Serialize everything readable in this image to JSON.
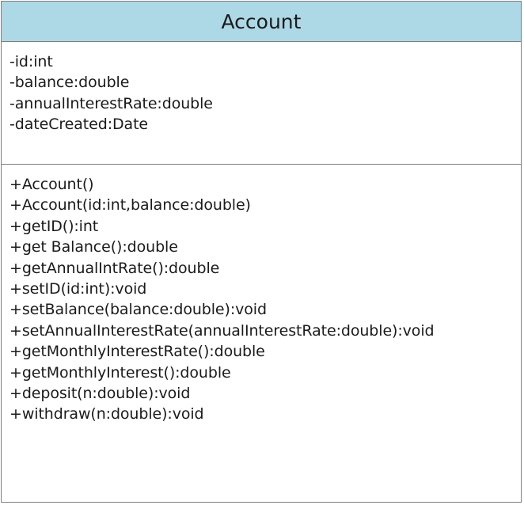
{
  "class": {
    "name": "Account",
    "header_color": "#add8e6",
    "attributes": [
      "-id:int",
      "-balance:double",
      "-annualInterestRate:double",
      "-dateCreated:Date"
    ],
    "methods": [
      "+Account()",
      "+Account(id:int,balance:double)",
      "+getID():int",
      "+get Balance():double",
      "+getAnnualIntRate():double",
      "+setID(id:int):void",
      "+setBalance(balance:double):void",
      "+setAnnualInterestRate(annualInterestRate:double):void",
      "+getMonthlyInterestRate():double",
      "+getMonthlyInterest():double",
      "+deposit(n:double):void",
      "+withdraw(n:double):void"
    ]
  }
}
